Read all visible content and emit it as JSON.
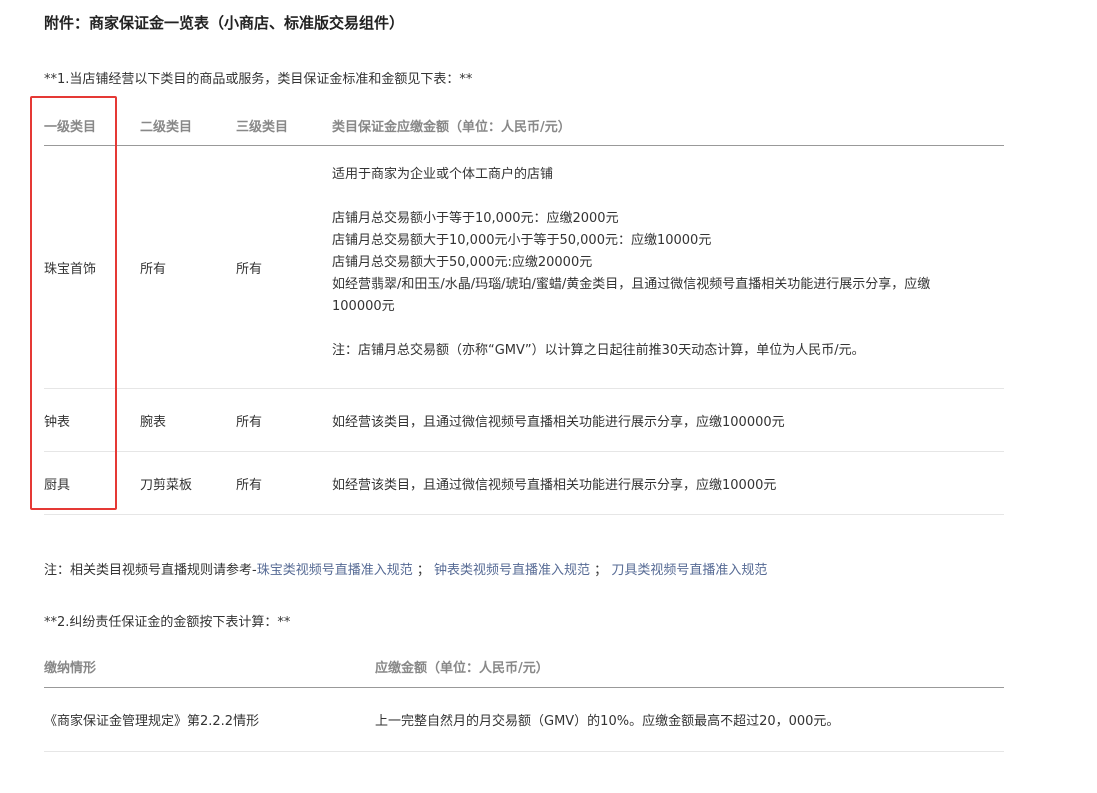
{
  "title": "附件：商家保证金一览表（小商店、标准版交易组件）",
  "section1_intro": "**1.当店铺经营以下类目的商品或服务，类目保证金标准和金额见下表：**",
  "table1": {
    "headers": [
      "一级类目",
      "二级类目",
      "三级类目",
      "类目保证金应缴金额（单位：人民币/元）"
    ],
    "rows": [
      {
        "c1": "珠宝首饰",
        "c2": "所有",
        "c3": "所有",
        "lines": [
          "适用于商家为企业或个体工商户的店铺",
          "",
          "店铺月总交易额小于等于10,000元：应缴2000元",
          "店铺月总交易额大于10,000元小于等于50,000元：应缴10000元",
          "店铺月总交易额大于50,000元:应缴20000元",
          "如经营翡翠/和田玉/水晶/玛瑙/琥珀/蜜蜡/黄金类目，且通过微信视频号直播相关功能进行展示分享，应缴",
          "100000元",
          "",
          "注：店铺月总交易额（亦称“GMV”）以计算之日起往前推30天动态计算，单位为人民币/元。"
        ]
      },
      {
        "c1": "钟表",
        "c2": "腕表",
        "c3": "所有",
        "c4": "如经营该类目，且通过微信视频号直播相关功能进行展示分享，应缴100000元"
      },
      {
        "c1": "厨具",
        "c2": "刀剪菜板",
        "c3": "所有",
        "c4": "如经营该类目，且通过微信视频号直播相关功能进行展示分享，应缴10000元"
      }
    ]
  },
  "note_rules": {
    "prefix": "注：相关类目视频号直播规则请参考-",
    "link1": "珠宝类视频号直播准入规范",
    "sep1": "；",
    "link2": "钟表类视频号直播准入规范",
    "sep2": "；",
    "link3": "刀具类视频号直播准入规范"
  },
  "section2_intro": "**2.纠纷责任保证金的金额按下表计算：**",
  "table2": {
    "headers": [
      "缴纳情形",
      "应缴金额（单位：人民币/元）"
    ],
    "rows": [
      {
        "c1": "《商家保证金管理规定》第2.2.2情形",
        "c2": "上一完整自然月的月交易额（GMV）的10%。应缴金额最高不超过20，000元。"
      }
    ]
  },
  "colors": {
    "highlight": "#e53935",
    "link": "#576b95"
  }
}
